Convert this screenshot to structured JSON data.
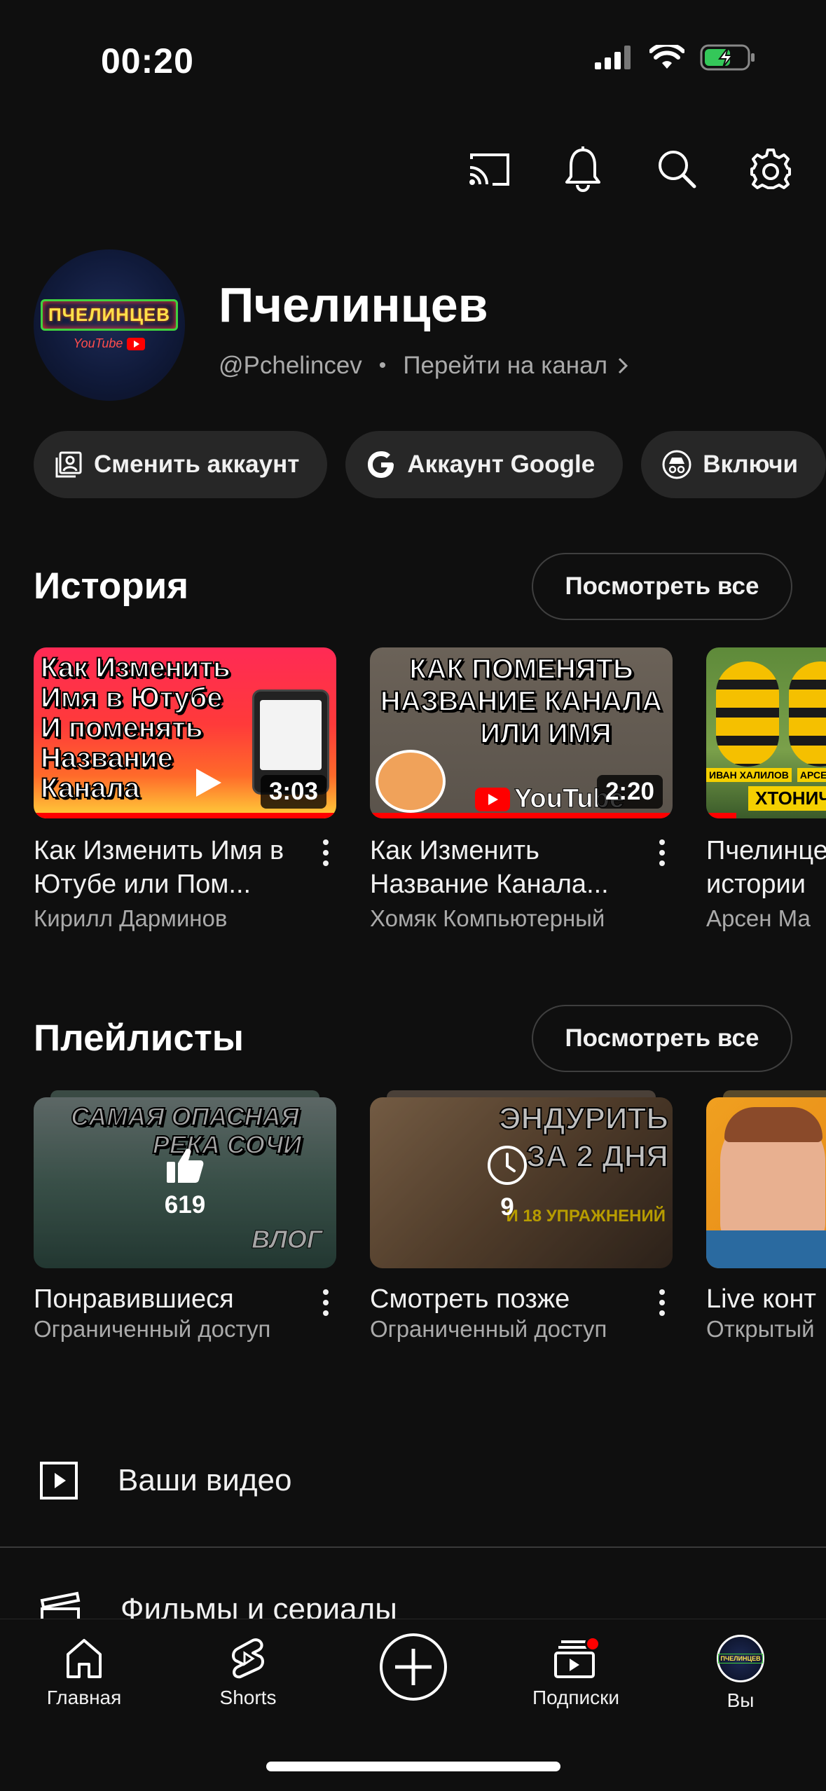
{
  "status_bar": {
    "time": "00:20"
  },
  "toolbar": {
    "icons": [
      "cast-icon",
      "bell-icon",
      "search-icon",
      "gear-icon"
    ]
  },
  "profile": {
    "name": "Пчелинцев",
    "handle": "@Pchelincev",
    "separator": "•",
    "go_to_channel": "Перейти на канал",
    "avatar_logo_text": "ПЧЕЛИНЦЕВ",
    "avatar_logo_sub": "YouTube"
  },
  "chips": [
    {
      "label": "Сменить аккаунт",
      "icon": "switch-account-icon"
    },
    {
      "label": "Аккаунт Google",
      "icon": "google-g-icon"
    },
    {
      "label": "Включи",
      "icon": "incognito-icon"
    }
  ],
  "history": {
    "title": "История",
    "see_all": "Посмотреть все",
    "videos": [
      {
        "title": "Как Изменить Имя в Ютубе или Пом...",
        "channel": "Кирилл Дарминов",
        "duration": "3:03",
        "thumb_text": [
          "Как Изменить",
          "Имя в Ютубе",
          "И поменять",
          "Название",
          "Канала"
        ],
        "progress": 1.0
      },
      {
        "title": "Как Изменить Название Канала...",
        "channel": "Хомяк Компьютерный",
        "duration": "2:20",
        "thumb_text": [
          "КАК ПОМЕНЯТЬ",
          "НАЗВАНИЕ КАНАЛА",
          "ИЛИ ИМЯ"
        ],
        "thumb_brand": "YouTube",
        "progress": 1.0
      },
      {
        "title": "Пчелинцев истории",
        "channel": "Арсен Ма",
        "duration": "",
        "thumb_labels": [
          "ИВАН ХАЛИЛОВ",
          "АРСЕН МАР",
          "ХТОНИЧ"
        ],
        "progress": 0.1
      }
    ]
  },
  "playlists": {
    "title": "Плейлисты",
    "see_all": "Посмотреть все",
    "items": [
      {
        "title": "Понравившиеся",
        "privacy": "Ограниченный доступ",
        "count": "619",
        "icon": "thumbs-up-icon",
        "thumb_text": [
          "САМАЯ ОПАСНАЯ",
          "РЕКА СОЧИ"
        ],
        "thumb_tag": "ВЛОГ"
      },
      {
        "title": "Смотреть позже",
        "privacy": "Ограниченный доступ",
        "count": "9",
        "icon": "clock-icon",
        "thumb_text": [
          "ЭНДУРИТЬ",
          "ЗА 2 ДНЯ"
        ],
        "thumb_tag": "И 18 УПРАЖНЕНИЙ"
      },
      {
        "title": "Live конт",
        "privacy": "Открытый",
        "count": "",
        "icon": ""
      }
    ]
  },
  "menu": [
    {
      "label": "Ваши видео",
      "icon": "play-square-icon"
    },
    {
      "label": "Фильмы и сериалы",
      "icon": "clapperboard-icon"
    }
  ],
  "bottom_nav": {
    "home": "Главная",
    "shorts": "Shorts",
    "subscriptions": "Подписки",
    "you": "Вы",
    "avatar_text": "ПЧЕЛИНЦЕВ"
  },
  "colors": {
    "background": "#0f0f0f",
    "chip": "#272727",
    "accent_red": "#ff0000",
    "secondary_text": "#aaaaaa"
  }
}
